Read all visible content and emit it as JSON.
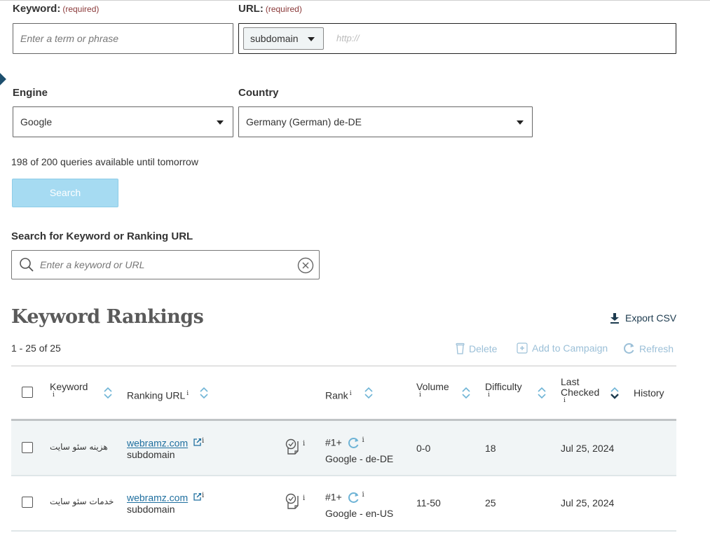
{
  "form": {
    "keyword_label": "Keyword:",
    "keyword_required": "(required)",
    "keyword_placeholder": "Enter a term or phrase",
    "url_label": "URL:",
    "url_required": "(required)",
    "url_type_select": "subdomain",
    "url_placeholder": "http://",
    "engine_label": "Engine",
    "engine_value": "Google",
    "country_label": "Country",
    "country_value": "Germany (German) de-DE",
    "quota_text": "198 of 200 queries available until tomorrow",
    "search_button": "Search"
  },
  "filter": {
    "label": "Search for Keyword or Ranking URL",
    "placeholder": "Enter a keyword or URL"
  },
  "rankings": {
    "title": "Keyword Rankings",
    "count_text": "1 - 25 of 25",
    "export_label": "Export CSV",
    "actions": {
      "delete": "Delete",
      "add_to_campaign": "Add to Campaign",
      "refresh": "Refresh"
    },
    "columns": {
      "keyword": "Keyword",
      "ranking_url": "Ranking URL",
      "rank": "Rank",
      "volume": "Volume",
      "difficulty": "Difficulty",
      "last_checked_1": "Last",
      "last_checked_2": "Checked",
      "history": "History"
    },
    "info_glyph": "i",
    "rows": [
      {
        "keyword": "هزینه سئو سایت",
        "url": "webramz.com",
        "url_type": "subdomain",
        "rank": "#1+",
        "engine_locale": "Google - de-DE",
        "volume": "0-0",
        "difficulty": "18",
        "last_checked": "Jul 25, 2024"
      },
      {
        "keyword": "خدمات سئو سایت",
        "url": "webramz.com",
        "url_type": "subdomain",
        "rank": "#1+",
        "engine_locale": "Google - en-US",
        "volume": "11-50",
        "difficulty": "25",
        "last_checked": "Jul 25, 2024"
      }
    ]
  }
}
